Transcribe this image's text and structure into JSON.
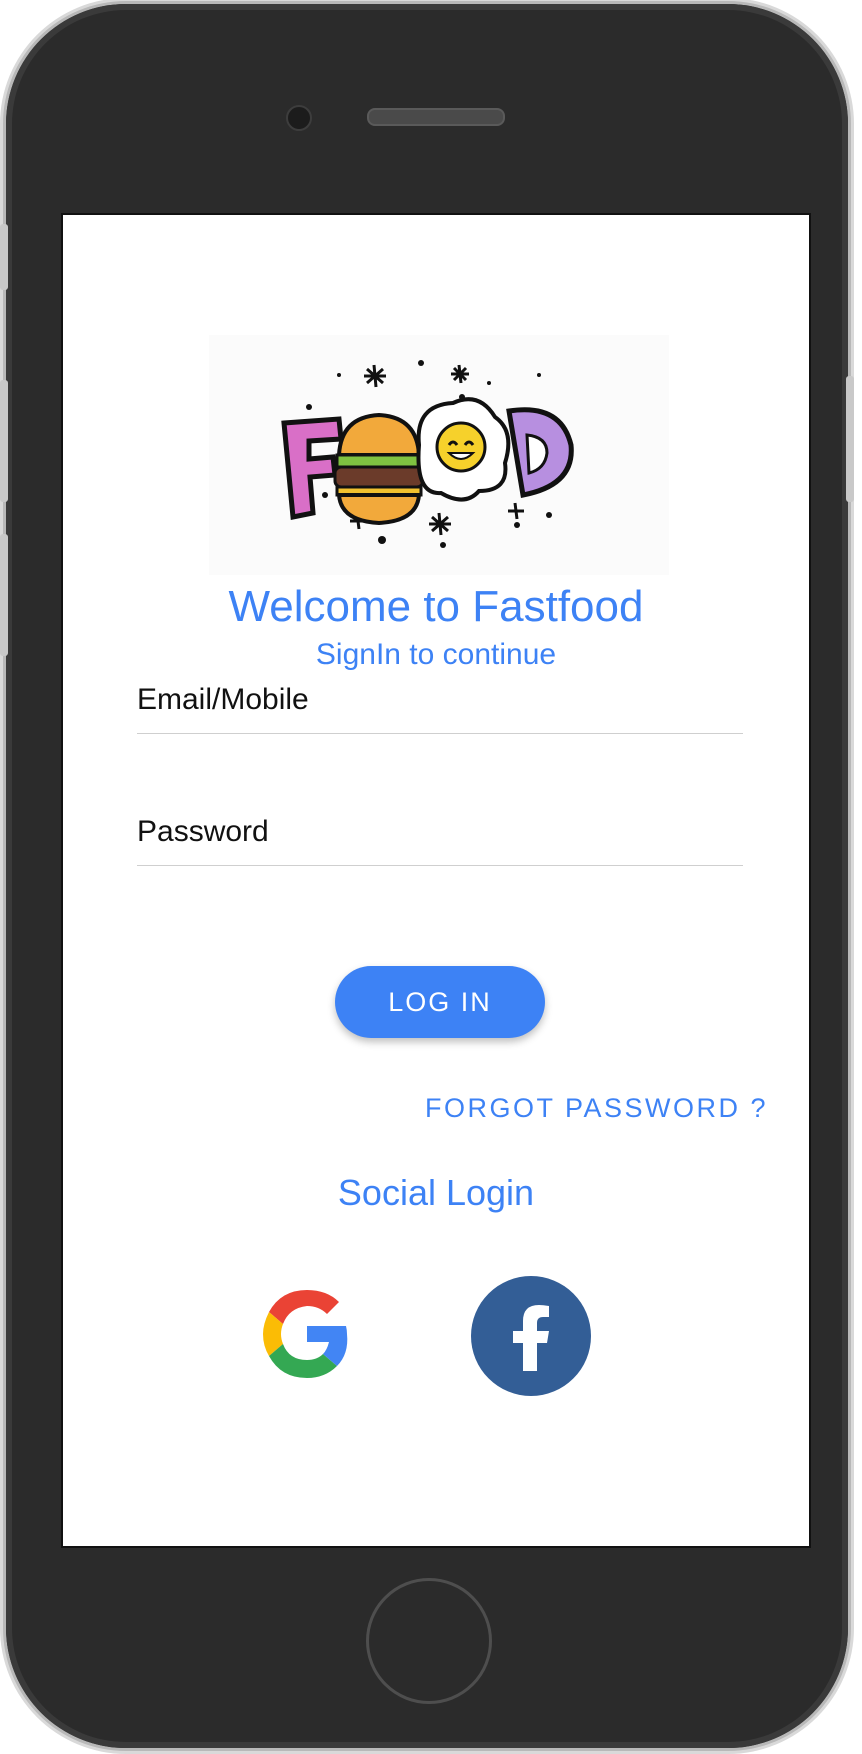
{
  "screen": {
    "title": "Welcome to Fastfood",
    "subtitle": "SignIn to continue"
  },
  "logo": {
    "text": "FOOD",
    "icon": "food-logo-icon"
  },
  "form": {
    "email_placeholder": "Email/Mobile",
    "password_placeholder": "Password",
    "login_label": "LOG IN",
    "forgot_label": "FORGOT PASSWORD ?"
  },
  "social": {
    "title": "Social Login",
    "google_icon": "google-icon",
    "facebook_icon": "facebook-icon"
  },
  "colors": {
    "accent": "#3d82f5",
    "facebook": "#335e96",
    "device_body": "#2b2b2b"
  }
}
